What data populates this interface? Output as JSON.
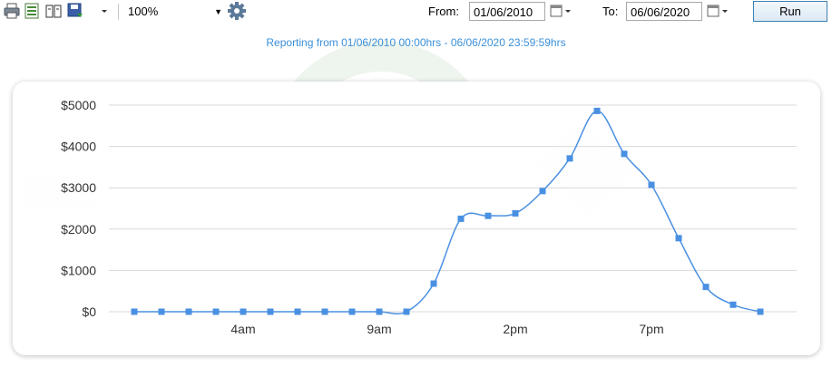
{
  "toolbar": {
    "zoom": "100%",
    "from_label": "From:",
    "from_date": "01/06/2010",
    "to_label": "To:",
    "to_date": "06/06/2020",
    "run_label": "Run",
    "icons": [
      "print-icon",
      "page-setup-icon",
      "book-icon",
      "save-icon",
      "gear-icon",
      "calendar-icon"
    ]
  },
  "report": {
    "subtitle": "Reporting from 01/06/2010 00:00hrs - 06/06/2020 23:59:59hrs"
  },
  "colors": {
    "series": "#4a90e2",
    "subtitle": "#3a8fd8",
    "grid": "#d9d9d9"
  },
  "chart_data": {
    "type": "line",
    "title": "",
    "xlabel": "",
    "ylabel": "",
    "x": [
      0,
      1,
      2,
      3,
      4,
      5,
      6,
      7,
      8,
      9,
      10,
      11,
      12,
      13,
      14,
      15,
      16,
      17,
      18,
      19,
      20,
      21,
      22,
      23
    ],
    "x_tick_labels": [
      {
        "x": 4,
        "label": "4am"
      },
      {
        "x": 9,
        "label": "9am"
      },
      {
        "x": 14,
        "label": "2pm"
      },
      {
        "x": 19,
        "label": "7pm"
      }
    ],
    "y_tick_labels": [
      "$0",
      "$1000",
      "$2000",
      "$3000",
      "$4000",
      "$5000"
    ],
    "y_ticks": [
      0,
      1000,
      2000,
      3000,
      4000,
      5000
    ],
    "ylim": [
      0,
      5000
    ],
    "series": [
      {
        "values": [
          0,
          0,
          0,
          0,
          0,
          0,
          0,
          0,
          0,
          0,
          0,
          680,
          2250,
          2320,
          2380,
          2920,
          3710,
          4860,
          3820,
          3070,
          1780,
          600,
          170,
          0
        ]
      }
    ],
    "grid": true,
    "legend": "none"
  }
}
